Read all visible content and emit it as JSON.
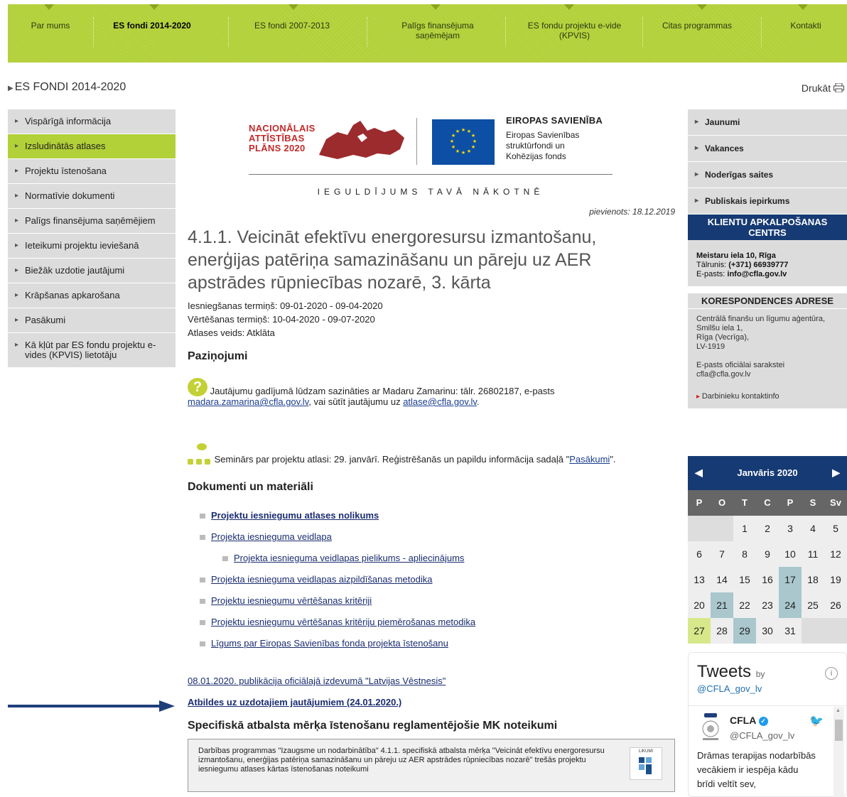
{
  "topnav": {
    "items": [
      "Par mums",
      "ES fondi 2014-2020",
      "ES fondi 2007-2013",
      "Palīgs finansējuma saņēmējam",
      "ES fondu projektu e-vide (KPVIS)",
      "Citas programmas",
      "Kontakti"
    ],
    "active": 1
  },
  "breadcrumb": "ES FONDI 2014-2020",
  "print_label": "Drukāt",
  "left_nav": [
    "Vispārīgā informācija",
    "Izsludinātās atlases",
    "Projektu īstenošana",
    "Normatīvie dokumenti",
    "Palīgs finansējuma saņēmējiem",
    "Ieteikumi projektu ieviešanā",
    "Biežāk uzdotie jautājumi",
    "Krāpšanas apkarošana",
    "Pasākumi",
    "Kā kļūt par ES fondu projektu e-vides (KPVIS) lietotāju"
  ],
  "left_nav_active": 1,
  "logo": {
    "nap_line1": "NACIONĀLAIS",
    "nap_line2": "ATTĪSTĪBAS",
    "nap_line3": "PLĀNS 2020",
    "eu_title": "EIROPAS SAVIENĪBA",
    "eu_line1": "Eiropas Savienības",
    "eu_line2": "struktūrfondi un",
    "eu_line3": "Kohēzijas fonds",
    "slogan": "IEGULDĪJUMS TAVĀ NĀKOTNĒ"
  },
  "added": "pievienots: 18.12.2019",
  "page_title": "4.1.1. Veicināt efektīvu energoresursu izmantošanu, enerģijas patēriņa samazināšanu un pāreju uz AER apstrādes rūpniecības nozarē, 3. kārta",
  "meta": {
    "submission": "Iesniegšanas termiņš: 09-01-2020 - 09-04-2020",
    "evaluation": "Vērtēšanas termiņš: 10-04-2020 - 09-07-2020",
    "type": "Atlases veids: Atklāta"
  },
  "notices_heading": "Paziņojumi",
  "notice1": {
    "text_a": "Jautājumu gadījumā lūdzam sazināties ar Madaru Zamarinu: tālr. 26802187, e-pasts ",
    "email1": "madara.zamarina@cfla.gov.lv",
    "text_b": ", vai sūtīt jautājumu uz ",
    "email2": "atlase@cfla.gov.lv",
    "text_c": "."
  },
  "notice2": {
    "text_a": "Seminārs par projektu atlasi: 29. janvārī. Reģistrēšanās un papildu informācija sadaļā \"",
    "link": "Pasākumi",
    "text_b": "\"."
  },
  "docs_heading": "Dokumenti un materiāli",
  "docs": [
    "Projektu iesniegumu atlases nolikums",
    "Projekta iesnieguma veidlapa",
    "Projekta iesnieguma veidlapas pielikums - apliecinājums",
    "Projekta iesnieguma veidlapas aizpildīšanas metodika",
    "Projektu iesniegumu vērtēšanas kritēriji",
    "Projektu iesniegumu vērtēšanas kritēriju piemērošanas metodika",
    "Līgums par Eiropas Savienības fonda projekta īstenošanu"
  ],
  "publication_link": "08.01.2020. publikācija oficiālajā izdevumā \"Latvijas Vēstnesis\"",
  "answers_link": "Atbildes uz uzdotajiem jautājumiem (24.01.2020.)",
  "mk_heading": "Specifiskā atbalsta mērķa īstenošanu reglamentējošie MK noteikumi",
  "mk_text": "Darbības programmas \"Izaugsme un nodarbinātība\" 4.1.1. specifiskā atbalsta mērķa \"Veicināt efektīvu energoresursu izmantošanu, enerģijas patēriņa samazināšanu un pāreju uz AER apstrādes rūpniecības nozarē\" trešās projektu iesniegumu atlases kārtas īstenošanas noteikumi",
  "mk_badge": "LIKUMI",
  "right_nav": [
    "Jaunumi",
    "Vakances",
    "Noderīgas saites",
    "Publiskais iepirkums"
  ],
  "client_center": {
    "heading": "KLIENTU APKALPOŠANAS CENTRS",
    "address": "Meistaru iela 10, Rīga",
    "phone_label": "Tālrunis: ",
    "phone": "(+371) 66939777",
    "email_label": "E-pasts: ",
    "email": "info@cfla.gov.lv"
  },
  "correspondence": {
    "heading": "KORESPONDENCES ADRESE",
    "lines": [
      "Centrālā finanšu un līgumu aģentūra,",
      "Smilšu iela 1,",
      "Rīga (Vecrīga),",
      "LV-1919"
    ],
    "email_label": "E-pasts oficiālai sarakstei",
    "email": "cfla@cfla.gov.lv",
    "staff_link": "Darbinieku kontaktinfo"
  },
  "calendar": {
    "month": "Janvāris 2020",
    "dow": [
      "P",
      "O",
      "T",
      "C",
      "P",
      "S",
      "Sv"
    ],
    "leading_blanks": 2,
    "days": 31,
    "trailing_blanks": 2,
    "event_days": [
      17,
      21,
      24,
      29
    ],
    "today": 27
  },
  "twitter": {
    "title": "Tweets",
    "by": "by",
    "handle_link": "@CFLA_gov_lv",
    "name": "CFLA",
    "handle": "@CFLA_gov_lv",
    "text": "Drāmas terapijas nodarbībās vecākiem ir iespēja kādu brīdi veltīt sev,"
  }
}
